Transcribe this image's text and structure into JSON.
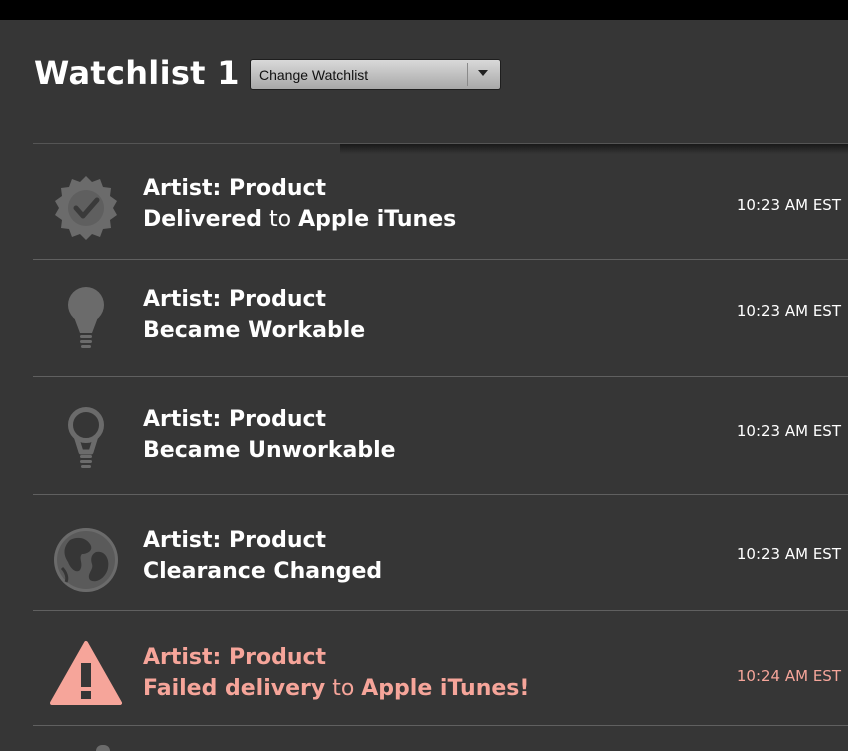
{
  "header": {
    "title": "Watchlist 1",
    "watchlist_select": {
      "selected": "Change Watchlist"
    }
  },
  "colors": {
    "background": "#363636",
    "text": "#ffffff",
    "icon_gray": "#6b6b6b",
    "alert": "#f6a59a"
  },
  "activity": [
    {
      "icon": "verified-badge-icon",
      "artist_product": "Artist: Product",
      "status_bold_1": "Delivered",
      "status_connector": " to ",
      "status_bold_2": "Apple iTunes",
      "time": "10:23 AM EST",
      "alert": false
    },
    {
      "icon": "lightbulb-on-icon",
      "artist_product": "Artist: Product",
      "status_bold_1": "Became Workable",
      "time": "10:23 AM EST",
      "alert": false
    },
    {
      "icon": "lightbulb-off-icon",
      "artist_product": "Artist: Product",
      "status_bold_1": "Became Unworkable",
      "time": "10:23 AM EST",
      "alert": false
    },
    {
      "icon": "globe-icon",
      "artist_product": "Artist: Product",
      "status_bold_1": "Clearance Changed",
      "time": "10:23 AM EST",
      "alert": false
    },
    {
      "icon": "warning-icon",
      "artist_product": "Artist: Product",
      "status_bold_1": "Failed delivery",
      "status_connector": " to ",
      "status_bold_2": "Apple iTunes!",
      "time": "10:24 AM EST",
      "alert": true
    }
  ]
}
